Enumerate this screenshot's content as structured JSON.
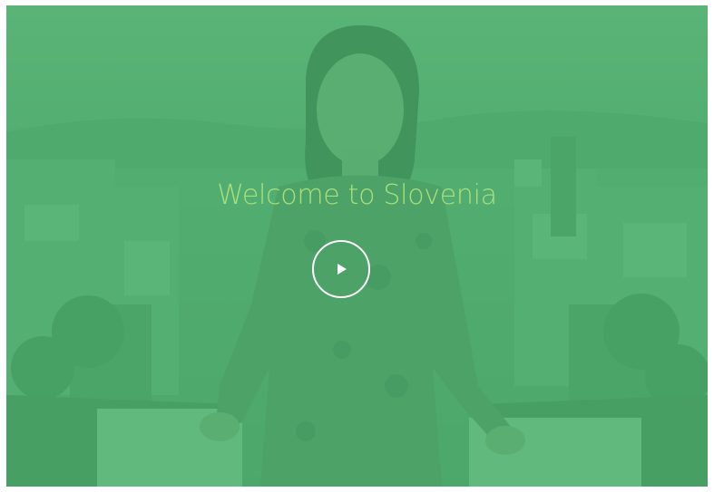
{
  "hero": {
    "title": "Welcome to Slovenia",
    "play_icon": "play-icon",
    "overlay_color": "#4eb26e",
    "title_color": "#a8e07c"
  }
}
